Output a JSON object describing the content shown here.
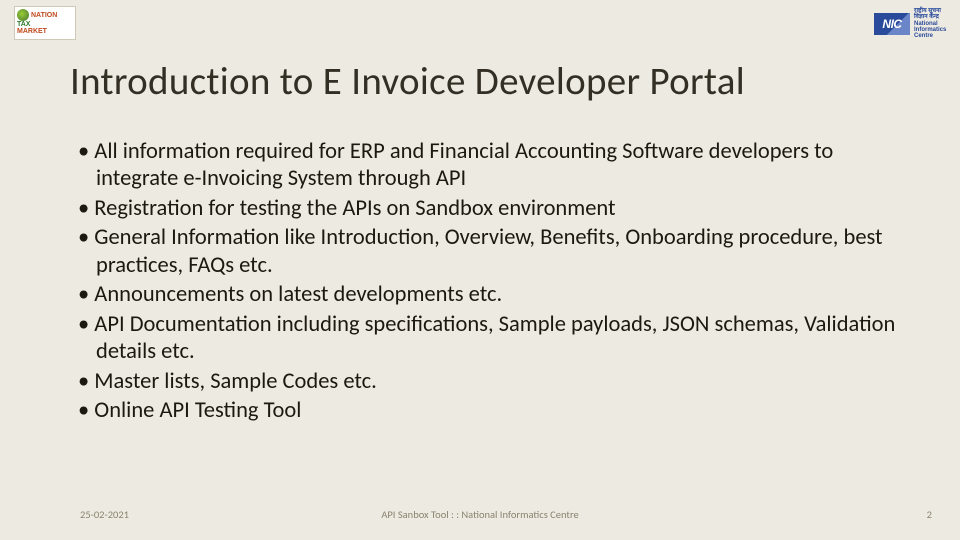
{
  "logo_left": {
    "line1_word1": "NATION",
    "line2_word1": "TAX",
    "line3_word1": "MARKET"
  },
  "logo_right": {
    "abbr": "NIC",
    "full": "राष्ट्रीय सूचना विज्ञान केन्द्र National Informatics Centre"
  },
  "title": "Introduction to E Invoice Developer Portal",
  "bullets": [
    "All information required for ERP and Financial Accounting Software developers to integrate e-Invoicing System through API",
    "Registration for testing the APIs on Sandbox environment",
    "General Information like Introduction, Overview, Benefits, Onboarding procedure, best practices, FAQs etc.",
    "Announcements on latest developments etc.",
    "API Documentation including specifications, Sample payloads, JSON schemas, Validation details etc.",
    "Master lists, Sample Codes etc.",
    "Online API Testing Tool"
  ],
  "footer": {
    "date": "25-02-2021",
    "center": "API Sanbox Tool  : :  National Informatics Centre",
    "page": "2"
  }
}
